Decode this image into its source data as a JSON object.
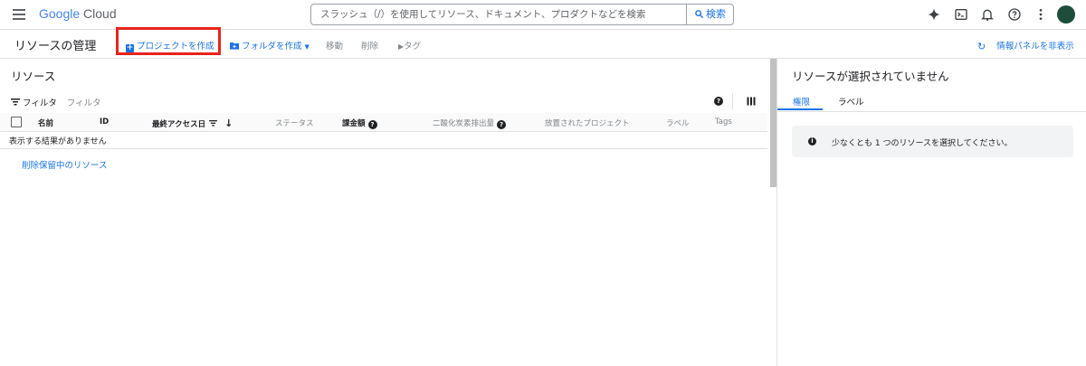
{
  "header": {
    "logo_google": "Google",
    "logo_cloud": "Cloud",
    "search_placeholder": "スラッシュ（/）を使用してリソース、ドキュメント、プロダクトなどを検索",
    "search_button": "検索"
  },
  "toolbar": {
    "page_title": "リソースの管理",
    "create_project": "プロジェクトを作成",
    "create_folder": "フォルダを作成",
    "move": "移動",
    "delete": "削除",
    "tag": "タグ",
    "hide_info_panel": "情報パネルを非表示"
  },
  "resources": {
    "title": "リソース",
    "filter_label": "フィルタ",
    "filter_placeholder": "フィルタ",
    "columns": {
      "name": "名前",
      "id": "ID",
      "last_access": "最終アクセス日",
      "status": "ステータス",
      "charges": "課金額",
      "carbon": "二酸化炭素排出量",
      "abandoned": "放置されたプロジェクト",
      "labels": "ラベル",
      "tags": "Tags"
    },
    "empty_message": "表示する結果がありません",
    "pending_deletion_link": "削除保留中のリソース"
  },
  "info_panel": {
    "title": "リソースが選択されていません",
    "tabs": [
      "権限",
      "ラベル"
    ],
    "message": "少なくとも 1 つのリソースを選択してください。"
  },
  "colors": {
    "accent": "#1a73e8",
    "highlight_box": "#e8241a",
    "avatar": "#1e4d3b"
  }
}
